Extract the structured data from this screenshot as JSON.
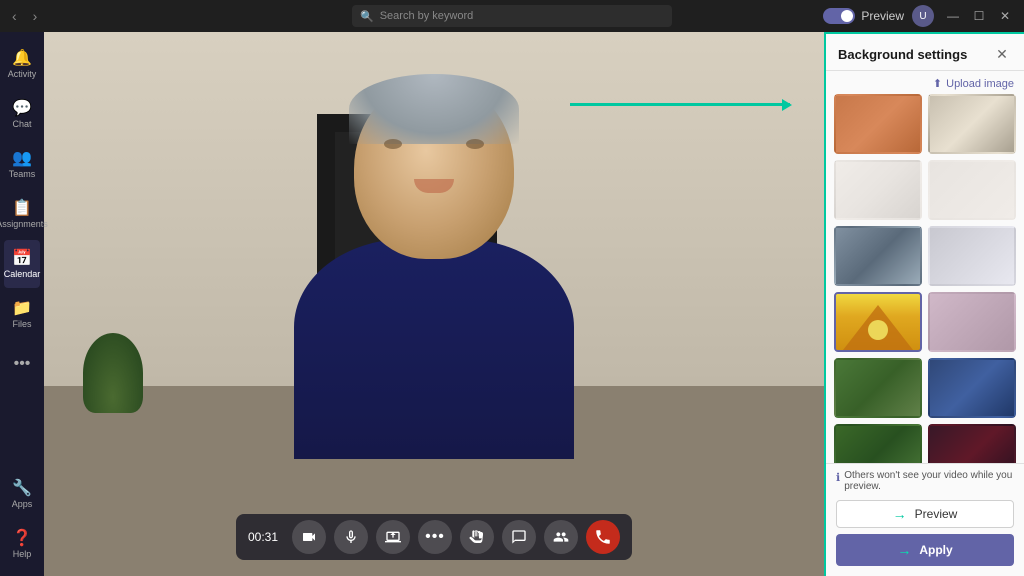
{
  "titleBar": {
    "searchPlaceholder": "Search by keyword",
    "previewLabel": "Preview",
    "windowControls": {
      "minimize": "—",
      "maximize": "☐",
      "close": "✕"
    }
  },
  "sidebar": {
    "items": [
      {
        "icon": "🔔",
        "label": "Activity",
        "active": false
      },
      {
        "icon": "💬",
        "label": "Chat",
        "active": false
      },
      {
        "icon": "👥",
        "label": "Teams",
        "active": false
      },
      {
        "icon": "📋",
        "label": "Assignments",
        "active": false
      },
      {
        "icon": "📅",
        "label": "Calendar",
        "active": true
      },
      {
        "icon": "📁",
        "label": "Files",
        "active": false
      },
      {
        "icon": "⋯",
        "label": "...",
        "active": false
      }
    ],
    "bottomItems": [
      {
        "icon": "🔧",
        "label": "Apps"
      },
      {
        "icon": "❓",
        "label": "Help"
      }
    ]
  },
  "controls": {
    "timer": "00:31",
    "buttons": [
      {
        "id": "camera",
        "icon": "📷"
      },
      {
        "id": "mic",
        "icon": "🎤"
      },
      {
        "id": "share",
        "icon": "📤"
      },
      {
        "id": "more",
        "icon": "⋯"
      },
      {
        "id": "hand",
        "icon": "✋"
      },
      {
        "id": "chat",
        "icon": "💬"
      },
      {
        "id": "people",
        "icon": "👥"
      },
      {
        "id": "end",
        "icon": "📵"
      }
    ]
  },
  "bgPanel": {
    "title": "Background settings",
    "closeIcon": "✕",
    "uploadLabel": "Upload image",
    "thumbnails": [
      {
        "id": 1,
        "class": "bg-1",
        "alt": "Orange room"
      },
      {
        "id": 2,
        "class": "bg-2",
        "alt": "White room"
      },
      {
        "id": 3,
        "class": "bg-3",
        "alt": "Bright office"
      },
      {
        "id": 4,
        "class": "bg-4",
        "alt": "White minimalist"
      },
      {
        "id": 5,
        "class": "bg-5",
        "alt": "City view"
      },
      {
        "id": 6,
        "class": "bg-6",
        "alt": "Minimal white"
      },
      {
        "id": 7,
        "class": "bg-7",
        "alt": "Yellow tent",
        "selected": true
      },
      {
        "id": 8,
        "class": "bg-8",
        "alt": "Abstract pink"
      },
      {
        "id": 9,
        "class": "bg-9",
        "alt": "Gaming room"
      },
      {
        "id": 10,
        "class": "bg-10",
        "alt": "Blue office"
      },
      {
        "id": 11,
        "class": "bg-11",
        "alt": "Minecraft forest"
      },
      {
        "id": 12,
        "class": "bg-12",
        "alt": "Dark scene"
      }
    ],
    "previewNote": "Others won't see your video while you preview.",
    "previewBtnLabel": "Preview",
    "applyBtnLabel": "Apply"
  }
}
